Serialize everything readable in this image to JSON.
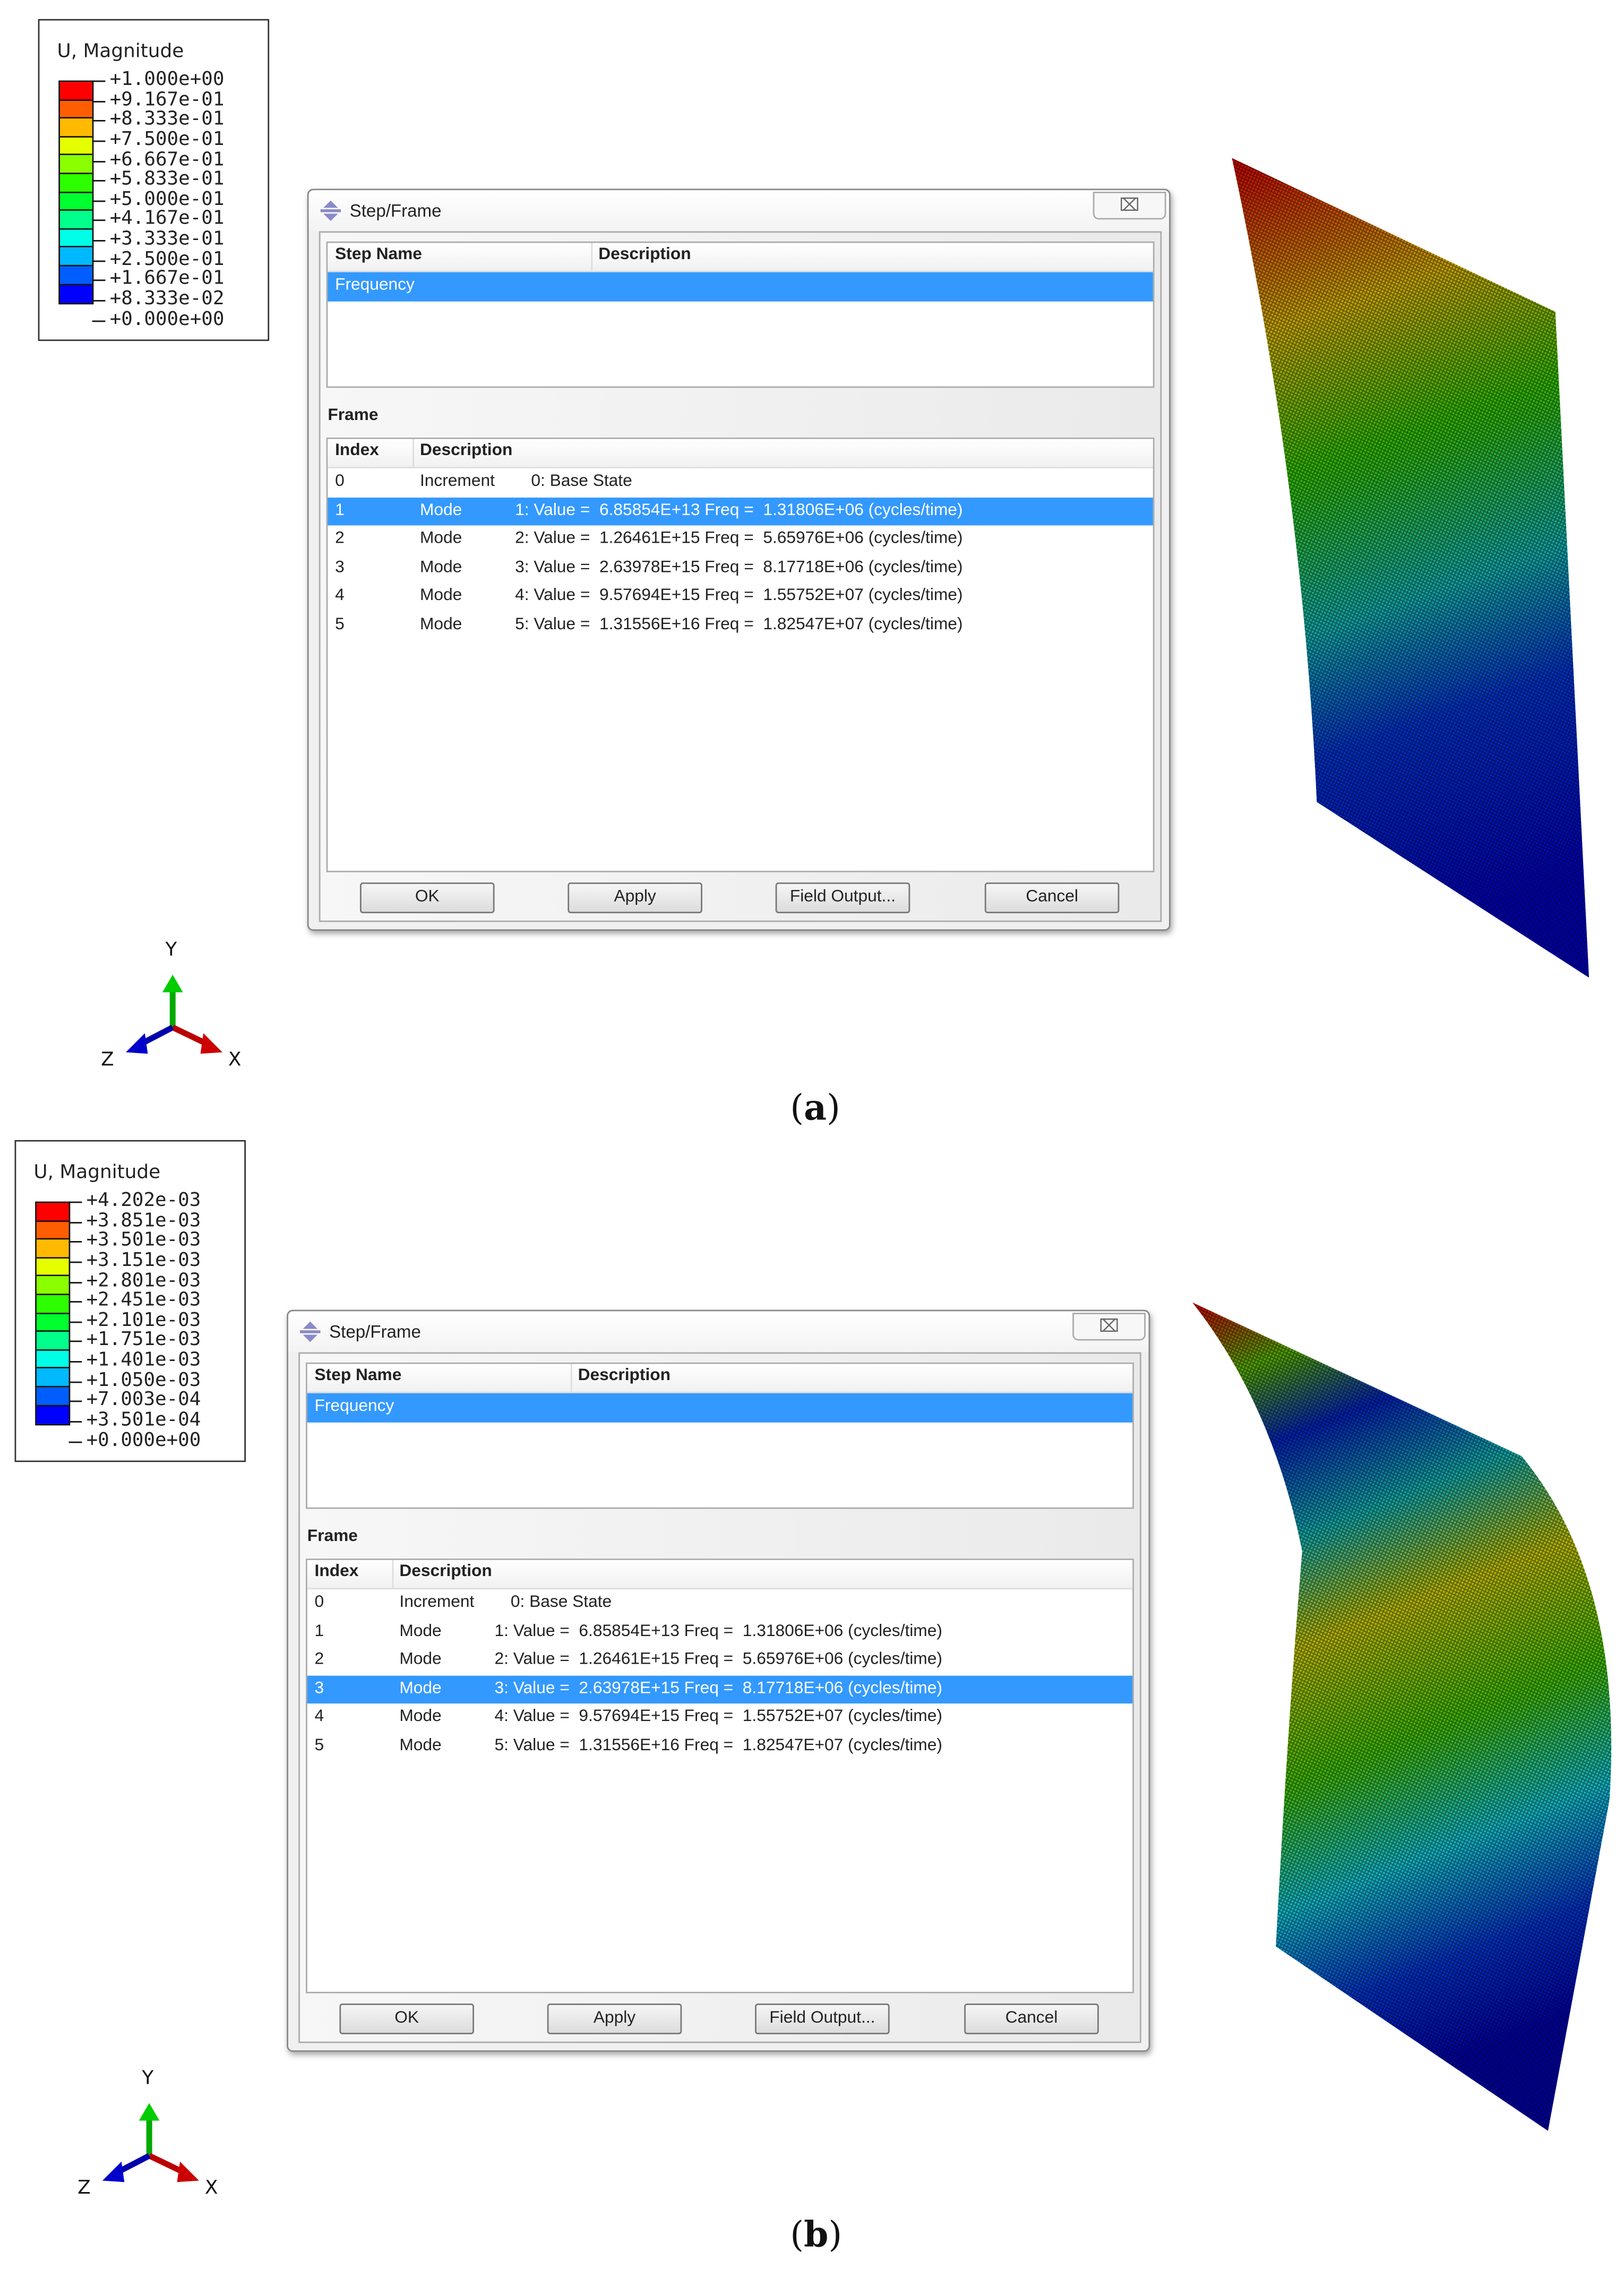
{
  "colors": [
    "#FF0000",
    "#FF5E00",
    "#FFB900",
    "#E6FF00",
    "#8BFF00",
    "#2EFF00",
    "#00FF2E",
    "#00FF8B",
    "#00FFE6",
    "#00B9FF",
    "#005EFF",
    "#0000FF"
  ],
  "panels": [
    {
      "caption": "a",
      "legend": {
        "title": "U, Magnitude",
        "values": [
          "+1.000e+00",
          "+9.167e-01",
          "+8.333e-01",
          "+7.500e-01",
          "+6.667e-01",
          "+5.833e-01",
          "+5.000e-01",
          "+4.167e-01",
          "+3.333e-01",
          "+2.500e-01",
          "+1.667e-01",
          "+8.333e-02",
          "+0.000e+00"
        ]
      },
      "dialog": {
        "title": "Step/Frame",
        "close": "⌧",
        "step_headers": [
          "Step Name",
          "Description"
        ],
        "steps": [
          {
            "name": "Frequency",
            "description": "",
            "selected": true
          }
        ],
        "frame_label": "Frame",
        "frame_headers": [
          "Index",
          "Description"
        ],
        "selected_frame": 1,
        "frames": [
          {
            "index": "0",
            "type": "Increment",
            "desc": "0: Base State"
          },
          {
            "index": "1",
            "type": "Mode",
            "desc": "1: Value =  6.85854E+13 Freq =  1.31806E+06 (cycles/time)"
          },
          {
            "index": "2",
            "type": "Mode",
            "desc": "2: Value =  1.26461E+15 Freq =  5.65976E+06 (cycles/time)"
          },
          {
            "index": "3",
            "type": "Mode",
            "desc": "3: Value =  2.63978E+15 Freq =  8.17718E+06 (cycles/time)"
          },
          {
            "index": "4",
            "type": "Mode",
            "desc": "4: Value =  9.57694E+15 Freq =  1.55752E+07 (cycles/time)"
          },
          {
            "index": "5",
            "type": "Mode",
            "desc": "5: Value =  1.31556E+16 Freq =  1.82547E+07 (cycles/time)"
          }
        ],
        "buttons": {
          "ok": "OK",
          "apply": "Apply",
          "field_output": "Field Output...",
          "cancel": "Cancel"
        }
      },
      "axes": {
        "y": "Y",
        "z": "Z",
        "x": "X"
      }
    },
    {
      "caption": "b",
      "legend": {
        "title": "U, Magnitude",
        "values": [
          "+4.202e-03",
          "+3.851e-03",
          "+3.501e-03",
          "+3.151e-03",
          "+2.801e-03",
          "+2.451e-03",
          "+2.101e-03",
          "+1.751e-03",
          "+1.401e-03",
          "+1.050e-03",
          "+7.003e-04",
          "+3.501e-04",
          "+0.000e+00"
        ]
      },
      "dialog": {
        "title": "Step/Frame",
        "close": "⌧",
        "step_headers": [
          "Step Name",
          "Description"
        ],
        "steps": [
          {
            "name": "Frequency",
            "description": "",
            "selected": true
          }
        ],
        "frame_label": "Frame",
        "frame_headers": [
          "Index",
          "Description"
        ],
        "selected_frame": 3,
        "frames": [
          {
            "index": "0",
            "type": "Increment",
            "desc": "0: Base State"
          },
          {
            "index": "1",
            "type": "Mode",
            "desc": "1: Value =  6.85854E+13 Freq =  1.31806E+06 (cycles/time)"
          },
          {
            "index": "2",
            "type": "Mode",
            "desc": "2: Value =  1.26461E+15 Freq =  5.65976E+06 (cycles/time)"
          },
          {
            "index": "3",
            "type": "Mode",
            "desc": "3: Value =  2.63978E+15 Freq =  8.17718E+06 (cycles/time)"
          },
          {
            "index": "4",
            "type": "Mode",
            "desc": "4: Value =  9.57694E+15 Freq =  1.55752E+07 (cycles/time)"
          },
          {
            "index": "5",
            "type": "Mode",
            "desc": "5: Value =  1.31556E+16 Freq =  1.82547E+07 (cycles/time)"
          }
        ],
        "buttons": {
          "ok": "OK",
          "apply": "Apply",
          "field_output": "Field Output...",
          "cancel": "Cancel"
        }
      },
      "axes": {
        "y": "Y",
        "z": "Z",
        "x": "X"
      }
    }
  ]
}
